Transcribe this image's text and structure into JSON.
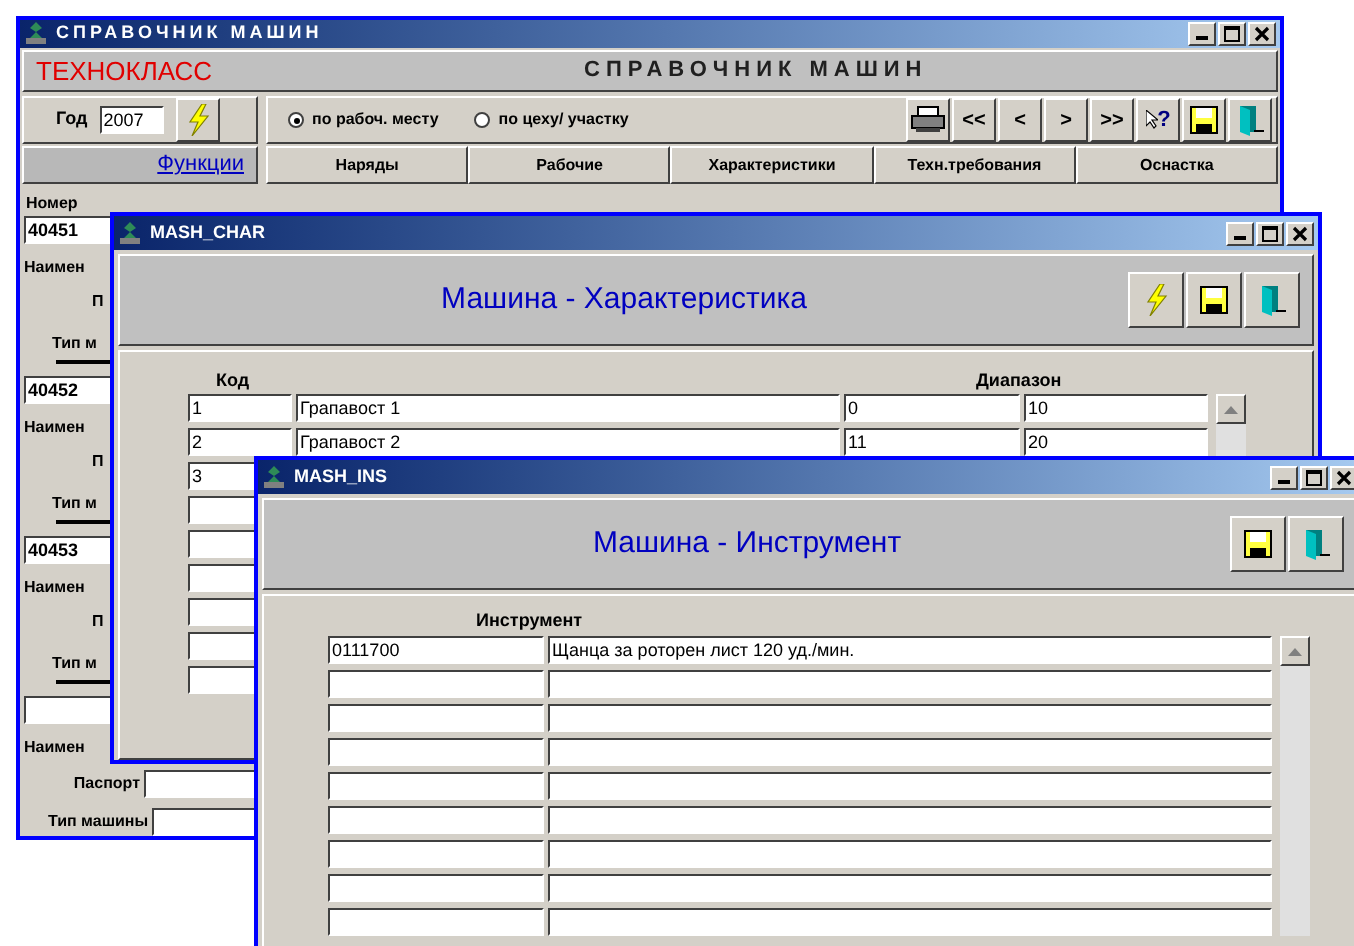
{
  "main_window": {
    "title": "СПРАВОЧНИК МАШИН",
    "brand": "ТЕХНОКЛАСС",
    "heading": "СПРАВОЧНИК МАШИН",
    "year": {
      "label": "Год",
      "value": "2007"
    },
    "radios": [
      {
        "label": "по рабоч. месту",
        "selected": true
      },
      {
        "label": "по цеху/ участку",
        "selected": false
      }
    ],
    "toolbar": [
      {
        "kind": "print"
      },
      {
        "kind": "text",
        "label": "<<"
      },
      {
        "kind": "text",
        "label": "<"
      },
      {
        "kind": "text",
        "label": ">"
      },
      {
        "kind": "text",
        "label": ">>"
      },
      {
        "kind": "help",
        "label": "?"
      },
      {
        "kind": "save"
      },
      {
        "kind": "exit"
      }
    ],
    "functions_link": "Функции",
    "tabs": [
      "Наряды",
      "Рабочие",
      "Характеристики",
      "Техн.требования",
      "Оснастка"
    ],
    "left_panel": {
      "number_label": "Номер",
      "records": [
        {
          "number": "40451",
          "labels": [
            "Наимен",
            "П",
            "Тип м"
          ]
        },
        {
          "number": "40452",
          "labels": [
            "Наимен",
            "П",
            "Тип м"
          ]
        },
        {
          "number": "40453",
          "labels": [
            "Наимен",
            "П",
            "Тип м"
          ]
        }
      ],
      "last": {
        "name_label": "Наимен",
        "passport_label": "Паспорт",
        "type_label": "Тип машины"
      }
    }
  },
  "char_window": {
    "title": "MASH_CHAR",
    "heading": "Машина - Характеристика",
    "buttons": [
      {
        "kind": "run"
      },
      {
        "kind": "save"
      },
      {
        "kind": "exit"
      }
    ],
    "columns": {
      "code": "Код",
      "range": "Диапазон"
    },
    "rows": [
      {
        "code": "1",
        "name": "Грапавост 1",
        "from": "0",
        "to": "10"
      },
      {
        "code": "2",
        "name": "Грапавост 2",
        "from": "11",
        "to": "20"
      },
      {
        "code": "3"
      }
    ]
  },
  "ins_window": {
    "title": "MASH_INS",
    "heading": "Машина - Инструмент",
    "buttons": [
      {
        "kind": "save"
      },
      {
        "kind": "exit"
      }
    ],
    "columns": {
      "tool": "Инструмент"
    },
    "rows": [
      {
        "code": "0111700",
        "name": "Щанца за роторен лист 120 уд./мин."
      }
    ]
  }
}
